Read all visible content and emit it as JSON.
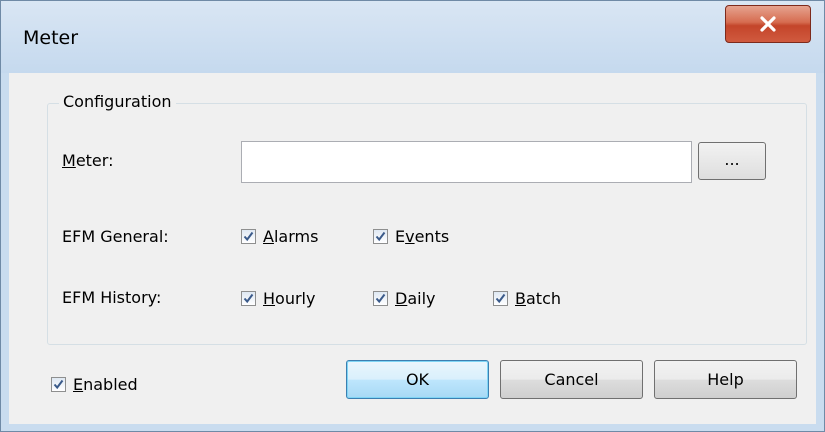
{
  "window": {
    "title": "Meter",
    "close_glyph": "X"
  },
  "configuration": {
    "group_label": "Configuration",
    "meter": {
      "label_first": "M",
      "label_rest": "eter:",
      "value": "",
      "browse_label": "..."
    },
    "efm_general": {
      "label": "EFM General:",
      "alarms": {
        "checked": true,
        "label_first": "A",
        "label_rest": "larms"
      },
      "events": {
        "checked": true,
        "label_first": "E",
        "label_mid": "v",
        "label_rest": "ents"
      }
    },
    "efm_history": {
      "label": "EFM History:",
      "hourly": {
        "checked": true,
        "label_first": "H",
        "label_rest": "ourly"
      },
      "daily": {
        "checked": true,
        "label_first": "D",
        "label_rest": "aily"
      },
      "batch": {
        "checked": true,
        "label_first": "B",
        "label_rest": "atch"
      }
    }
  },
  "enabled": {
    "checked": true,
    "label_first": "E",
    "label_rest": "nabled"
  },
  "buttons": {
    "ok": "OK",
    "cancel": "Cancel",
    "help": "Help"
  },
  "colors": {
    "check_mark": "#3a5a8a",
    "default_button_border": "#3c7fb1",
    "close_button": "#c4452a"
  }
}
